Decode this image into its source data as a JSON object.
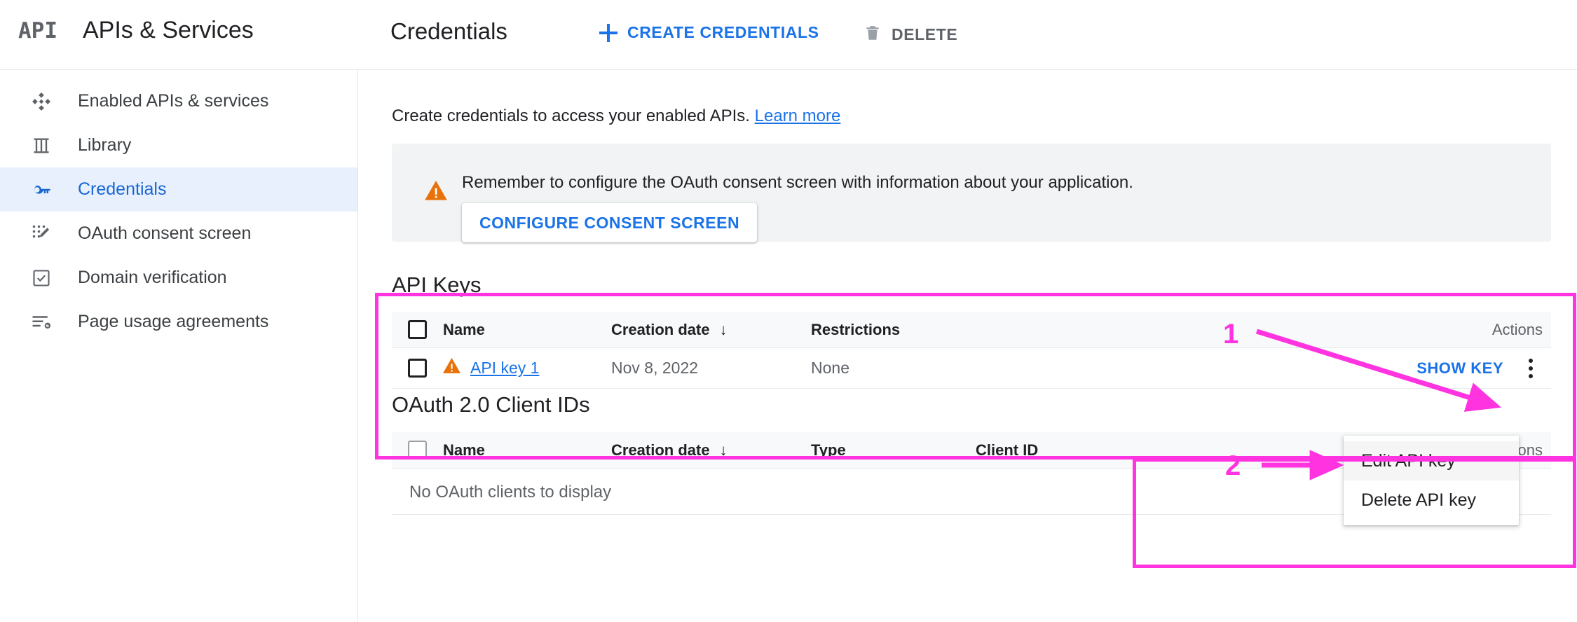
{
  "header": {
    "logo": "API",
    "brand_title": "APIs & Services",
    "page_title": "Credentials",
    "create_button": "CREATE CREDENTIALS",
    "delete_button": "DELETE"
  },
  "sidebar": {
    "items": [
      {
        "label": "Enabled APIs & services",
        "icon": "dashboard-diamond-icon",
        "active": false
      },
      {
        "label": "Library",
        "icon": "library-icon",
        "active": false
      },
      {
        "label": "Credentials",
        "icon": "key-icon",
        "active": true
      },
      {
        "label": "OAuth consent screen",
        "icon": "consent-screen-icon",
        "active": false
      },
      {
        "label": "Domain verification",
        "icon": "check-box-icon",
        "active": false
      },
      {
        "label": "Page usage agreements",
        "icon": "page-agreements-icon",
        "active": false
      }
    ]
  },
  "main": {
    "description": "Create credentials to access your enabled APIs.",
    "learn_more": "Learn more",
    "notice": {
      "icon": "warning-icon",
      "text": "Remember to configure the OAuth consent screen with information about your application.",
      "button": "CONFIGURE CONSENT SCREEN"
    },
    "api_keys": {
      "title": "API Keys",
      "columns": [
        "Name",
        "Creation date",
        "Restrictions",
        "Actions"
      ],
      "sort_column": "Creation date",
      "sort_arrow": "↓",
      "rows": [
        {
          "name": "API key 1",
          "name_icon": "warning-icon",
          "creation_date": "Nov 8, 2022",
          "restrictions": "None",
          "action_link": "SHOW KEY",
          "menu_icon": "more-vert-icon"
        }
      ]
    },
    "oauth_clients": {
      "title": "OAuth 2.0 Client IDs",
      "columns": [
        "Name",
        "Creation date",
        "Type",
        "Client ID",
        "Actions"
      ],
      "sort_column": "Creation date",
      "sort_arrow": "↓",
      "empty_message": "No OAuth clients to display"
    }
  },
  "context_menu": {
    "items": [
      {
        "label": "Edit API key",
        "hovered": true
      },
      {
        "label": "Delete API key",
        "hovered": false
      }
    ]
  },
  "annotations": {
    "markers": [
      {
        "number": "1",
        "target": "row-actions-kebab-menu"
      },
      {
        "number": "2",
        "target": "edit-api-key-menu-item"
      }
    ],
    "color": "#ff33e0"
  },
  "colors": {
    "accent_blue": "#1a73e8",
    "active_nav_bg": "#e8f0fe",
    "active_nav_text": "#1967d2",
    "notice_bg": "#f1f3f4",
    "table_head_bg": "#f8f9fa",
    "warning_orange": "#e8710a",
    "annotation_pink": "#ff33e0"
  }
}
